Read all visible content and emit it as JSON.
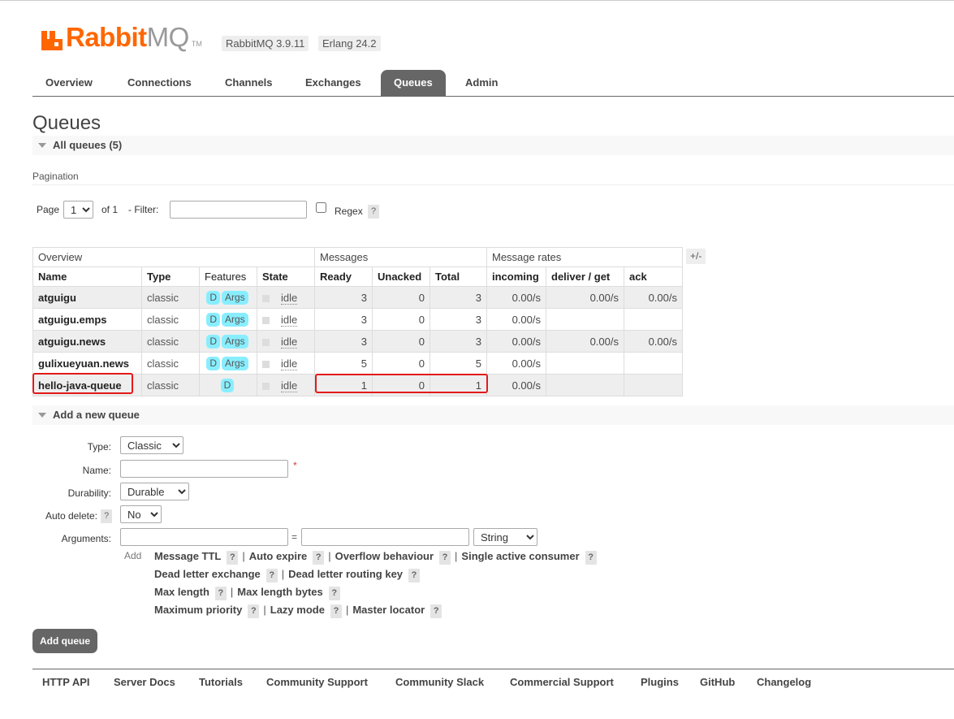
{
  "header": {
    "brand": "Rabbit",
    "brand_mq": "MQ",
    "tm": "TM",
    "version": "RabbitMQ 3.9.11",
    "erlang": "Erlang 24.2"
  },
  "menu": {
    "tabs": [
      "Overview",
      "Connections",
      "Channels",
      "Exchanges",
      "Queues",
      "Admin"
    ],
    "active": "Queues"
  },
  "page": {
    "title": "Queues",
    "all_queues": "All queues (5)",
    "pagination_label": "Pagination"
  },
  "pagination": {
    "page_label": "Page",
    "page_value": "1",
    "of_label": "of 1",
    "filter_label": "- Filter:",
    "filter_value": "",
    "regex_label": "Regex",
    "help": "?"
  },
  "table": {
    "groups": [
      "Overview",
      "Messages",
      "Message rates"
    ],
    "columns": [
      "Name",
      "Type",
      "Features",
      "State",
      "Ready",
      "Unacked",
      "Total",
      "incoming",
      "deliver / get",
      "ack"
    ],
    "plus_minus": "+/-",
    "rows": [
      {
        "name": "atguigu",
        "type": "classic",
        "features": [
          "D",
          "Args"
        ],
        "state": "idle",
        "ready": "3",
        "unacked": "0",
        "total": "3",
        "incoming": "0.00/s",
        "deliver": "0.00/s",
        "ack": "0.00/s"
      },
      {
        "name": "atguigu.emps",
        "type": "classic",
        "features": [
          "D",
          "Args"
        ],
        "state": "idle",
        "ready": "3",
        "unacked": "0",
        "total": "3",
        "incoming": "0.00/s",
        "deliver": "",
        "ack": ""
      },
      {
        "name": "atguigu.news",
        "type": "classic",
        "features": [
          "D",
          "Args"
        ],
        "state": "idle",
        "ready": "3",
        "unacked": "0",
        "total": "3",
        "incoming": "0.00/s",
        "deliver": "0.00/s",
        "ack": "0.00/s"
      },
      {
        "name": "gulixueyuan.news",
        "type": "classic",
        "features": [
          "D",
          "Args"
        ],
        "state": "idle",
        "ready": "5",
        "unacked": "0",
        "total": "5",
        "incoming": "0.00/s",
        "deliver": "",
        "ack": ""
      },
      {
        "name": "hello-java-queue",
        "type": "classic",
        "features": [
          "D"
        ],
        "state": "idle",
        "ready": "1",
        "unacked": "0",
        "total": "1",
        "incoming": "0.00/s",
        "deliver": "",
        "ack": ""
      }
    ]
  },
  "add_queue": {
    "section_title": "Add a new queue",
    "type_label": "Type:",
    "type_value": "Classic",
    "name_label": "Name:",
    "name_value": "",
    "required_mark": "*",
    "durability_label": "Durability:",
    "durability_value": "Durable",
    "auto_delete_label": "Auto delete:",
    "auto_delete_value": "No",
    "arguments_label": "Arguments:",
    "equals": "=",
    "arg_type_value": "String",
    "add_small": "Add",
    "arg_rows": [
      [
        "Message TTL",
        "Auto expire",
        "Overflow behaviour",
        "Single active consumer"
      ],
      [
        "Dead letter exchange",
        "Dead letter routing key"
      ],
      [
        "Max length",
        "Max length bytes"
      ],
      [
        "Maximum priority",
        "Lazy mode",
        "Master locator"
      ]
    ],
    "separator": "|",
    "button": "Add queue"
  },
  "footer": {
    "links": [
      "HTTP API",
      "Server Docs",
      "Tutorials",
      "Community Support",
      "Community Slack",
      "Commercial Support",
      "Plugins",
      "GitHub",
      "Changelog"
    ]
  },
  "colors": {
    "brand": "#ff6600",
    "active_tab": "#666666",
    "feature_pill": "#88eeff",
    "highlight": "#e31a1a"
  }
}
